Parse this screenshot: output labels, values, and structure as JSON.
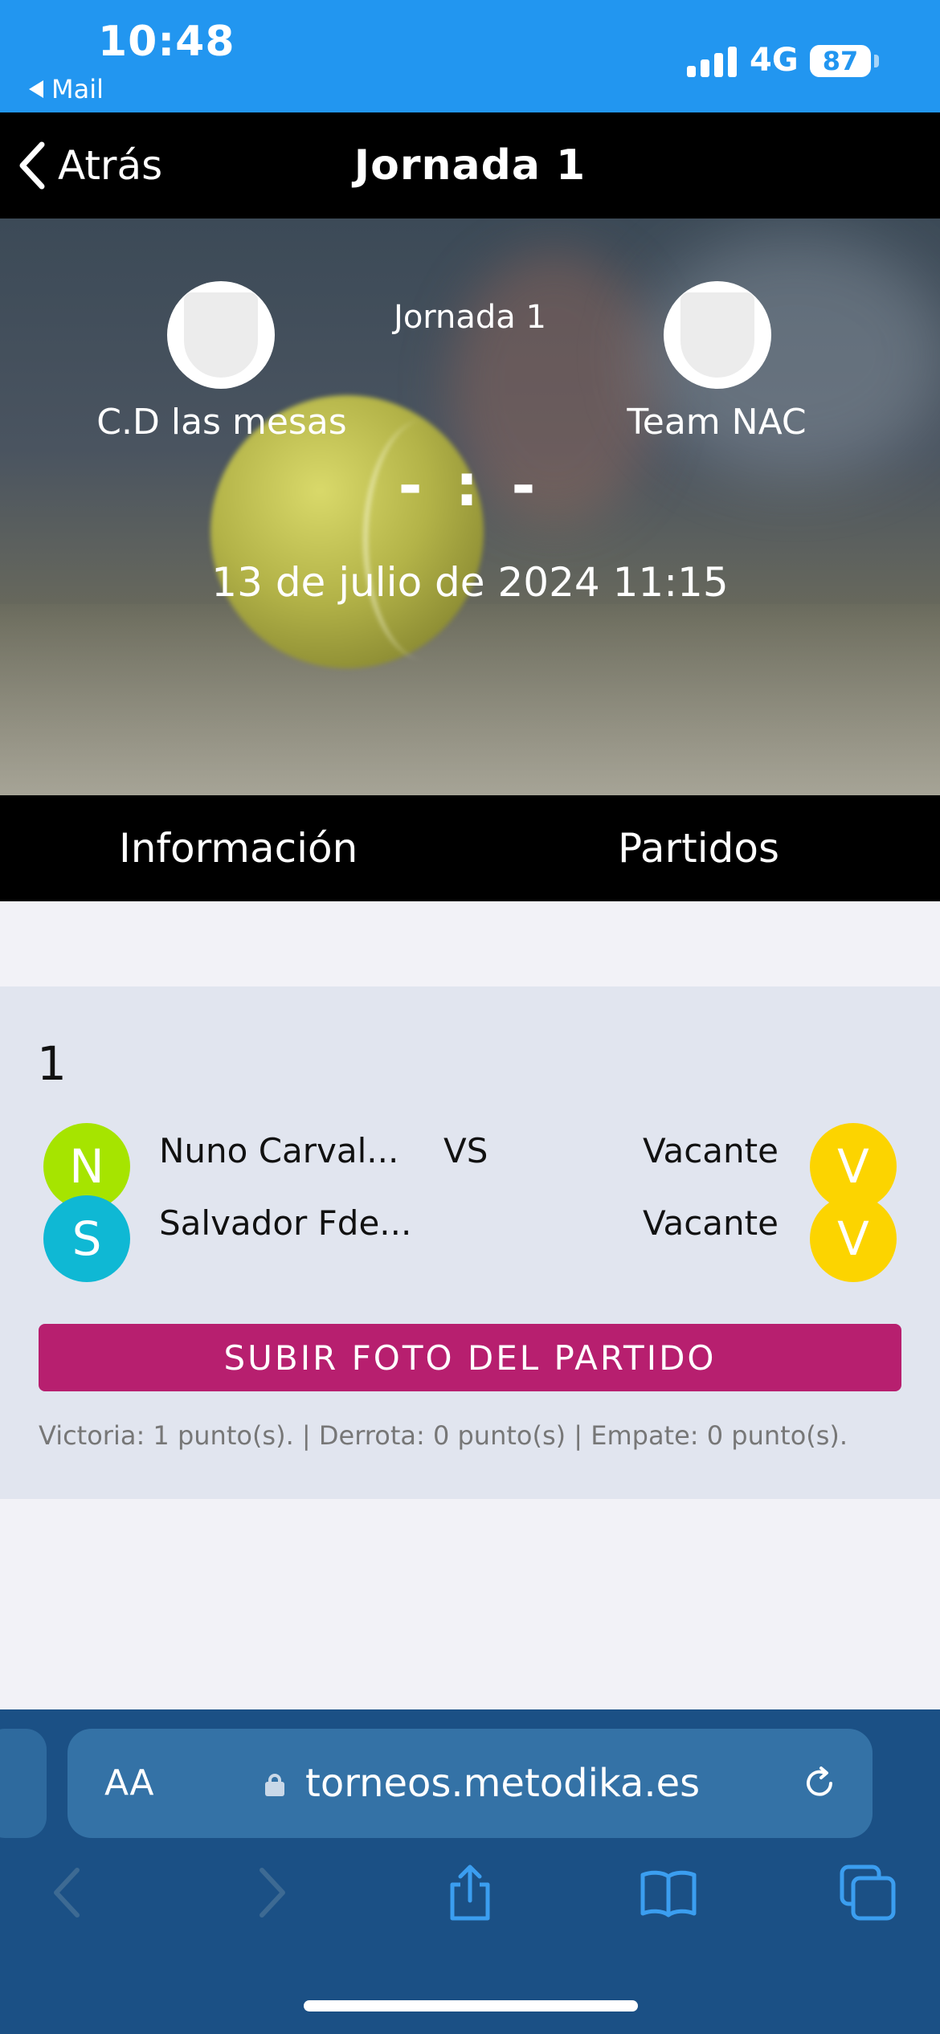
{
  "status_bar": {
    "time": "10:48",
    "back_app": "Mail",
    "network": "4G",
    "battery": "87"
  },
  "nav": {
    "back_label": "Atrás",
    "title": "Jornada 1"
  },
  "hero": {
    "round": "Jornada 1",
    "home_team": "C.D las mesas",
    "away_team": "Team NAC",
    "score": "- : -",
    "date": "13 de julio de 2024 11:15"
  },
  "tabs": [
    {
      "label": "Información"
    },
    {
      "label": "Partidos"
    }
  ],
  "match": {
    "number": "1",
    "vs": "VS",
    "home_players": [
      {
        "initial": "N",
        "name": "Nuno Carval...",
        "color": "#a6e400"
      },
      {
        "initial": "S",
        "name": "Salvador Fde...",
        "color": "#0fb8d4"
      }
    ],
    "away_players": [
      {
        "initial": "V",
        "name": "Vacante",
        "color": "#fcd400"
      },
      {
        "initial": "V",
        "name": "Vacante",
        "color": "#fcd400"
      }
    ],
    "upload_button": "SUBIR FOTO DEL PARTIDO",
    "scoring": "Victoria: 1 punto(s). | Derrota: 0 punto(s) | Empate: 0 punto(s)."
  },
  "browser": {
    "aa_label": "AA",
    "url": "torneos.metodika.es"
  },
  "colors": {
    "status_bar": "#2296f0",
    "accent_button": "#b71f6f",
    "safari_bar": "#1b5085"
  }
}
